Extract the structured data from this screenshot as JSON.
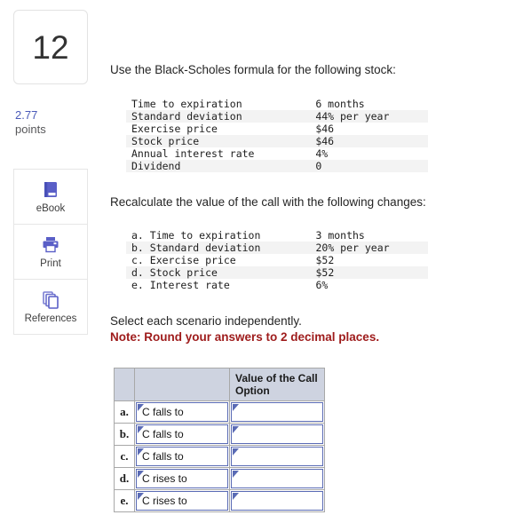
{
  "question": {
    "number": "12",
    "points_value": "2.77",
    "points_label": "points"
  },
  "tools": [
    {
      "label": "eBook",
      "icon": "book-icon"
    },
    {
      "label": "Print",
      "icon": "printer-icon"
    },
    {
      "label": "References",
      "icon": "pages-stack-icon"
    }
  ],
  "prompts": {
    "intro": "Use the Black-Scholes formula for the following stock:",
    "recalculate": "Recalculate the value of the call with the following changes:",
    "select_each": "Select each scenario independently.",
    "note": "Note: Round your answers to 2 decimal places."
  },
  "params_table": {
    "rows": [
      {
        "label": "Time to expiration",
        "value": "6 months"
      },
      {
        "label": "Standard deviation",
        "value": "44% per year"
      },
      {
        "label": "Exercise price",
        "value": "$46"
      },
      {
        "label": "Stock price",
        "value": "$46"
      },
      {
        "label": "Annual interest rate",
        "value": "4%"
      },
      {
        "label": "Dividend",
        "value": "0"
      }
    ]
  },
  "changes_table": {
    "rows": [
      {
        "label": "a. Time to expiration",
        "value": "3 months"
      },
      {
        "label": "b. Standard deviation",
        "value": "20% per year"
      },
      {
        "label": "c. Exercise price",
        "value": "$52"
      },
      {
        "label": "d. Stock price",
        "value": "$52"
      },
      {
        "label": "e. Interest rate",
        "value": "6%"
      }
    ]
  },
  "answer_table": {
    "header": {
      "col_letter": "",
      "col_text": "",
      "col_value": "Value of the Call Option"
    },
    "rows": [
      {
        "letter": "a.",
        "direction": "C falls to",
        "value": ""
      },
      {
        "letter": "b.",
        "direction": "C falls to",
        "value": ""
      },
      {
        "letter": "c.",
        "direction": "C falls to",
        "value": ""
      },
      {
        "letter": "d.",
        "direction": "C rises to",
        "value": ""
      },
      {
        "letter": "e.",
        "direction": "C rises to",
        "value": ""
      }
    ]
  },
  "colors": {
    "accent_purple": "#5a5fc7",
    "points_blue": "#4a5ab8",
    "note_red": "#9e1b1b",
    "header_fill": "#ced3e0",
    "input_border": "#5a6bb5",
    "row_stripe": "#f3f3f3"
  }
}
